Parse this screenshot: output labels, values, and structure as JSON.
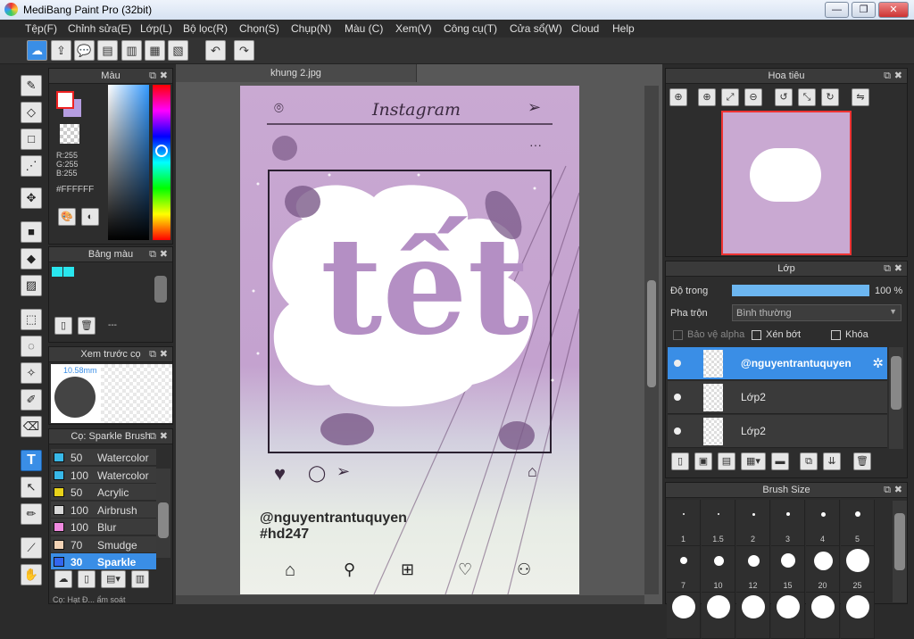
{
  "window": {
    "title": "MediBang Paint Pro (32bit)",
    "min": "—",
    "max": "❐",
    "close": "✕"
  },
  "menu": [
    "Tệp(F)",
    "Chỉnh sửa(E)",
    "Lớp(L)",
    "Bộ lọc(R)",
    "Chọn(S)",
    "Chụp(N)",
    "Màu (C)",
    "Xem(V)",
    "Công cụ(T)",
    "Cửa sổ(W)",
    "Cloud",
    "Help"
  ],
  "color_panel": {
    "title": "Màu",
    "r": "R:255",
    "g": "G:255",
    "b": "B:255",
    "hex": "#FFFFFF"
  },
  "palette_panel": {
    "title": "Bảng màu",
    "more": "---",
    "swatch_colors": [
      "#29e6ee",
      "#29e6ee"
    ]
  },
  "brush_preview": {
    "title": "Xem trước cọ",
    "size": "10.58mm"
  },
  "brush_panel": {
    "title": "Cọ: Sparkle Brush",
    "items": [
      {
        "size": "50",
        "name": "Watercolor",
        "color": "#38b8e8"
      },
      {
        "size": "100",
        "name": "Watercolor",
        "color": "#38b8e8"
      },
      {
        "size": "50",
        "name": "Acrylic",
        "color": "#e8d21a"
      },
      {
        "size": "100",
        "name": "Airbrush",
        "color": "#d8d8d8"
      },
      {
        "size": "100",
        "name": "Blur",
        "color": "#f08ae0"
      },
      {
        "size": "70",
        "name": "Smudge",
        "color": "#f3d3b5"
      },
      {
        "size": "30",
        "name": "Sparkle",
        "color": "#3366ee"
      }
    ],
    "bottom_cut": "Cọ: Hạt Đ...   ẩm soát"
  },
  "document": {
    "tab": "khung 2.jpg",
    "app": "Instagram",
    "username": "@nguyentrantuquyen",
    "hashtag": "#hd247",
    "art_text": "tết"
  },
  "nav_panel": {
    "title": "Hoa tiêu"
  },
  "layer_panel": {
    "title": "Lớp",
    "opacity_label": "Độ trong",
    "opacity_value": "100 %",
    "opacity": 1.0,
    "blend_label": "Pha trộn",
    "blend_value": "Bình thường",
    "protect_alpha": "Bảo vệ alpha",
    "clipping": "Xén bớt",
    "lock": "Khóa",
    "layers": [
      {
        "name": "@nguyentrantuquyen",
        "selected": true
      },
      {
        "name": "Lớp2",
        "selected": false
      },
      {
        "name": "Lớp2",
        "selected": false
      }
    ]
  },
  "brush_size_panel": {
    "title": "Brush Size",
    "sizes": [
      "1",
      "1.5",
      "2",
      "3",
      "4",
      "5",
      "7",
      "10",
      "12",
      "15",
      "20",
      "25",
      "",
      "",
      "",
      "",
      "",
      ""
    ]
  }
}
